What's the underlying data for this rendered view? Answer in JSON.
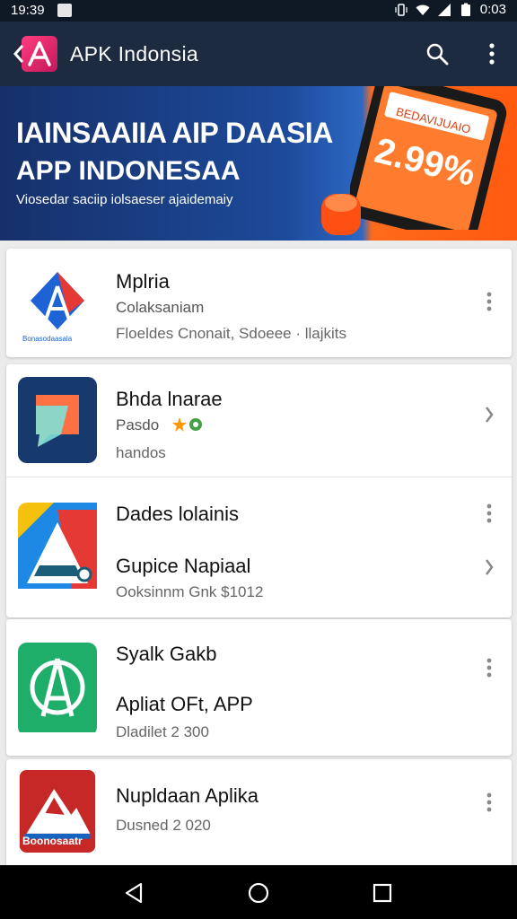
{
  "status_bar": {
    "time": "19:39",
    "clock_right": "0:03",
    "icons": [
      "notification-icon",
      "vibrate-icon",
      "wifi-icon",
      "signal-icon",
      "battery-icon"
    ]
  },
  "app_bar": {
    "title": "APK Indonsia",
    "back_icon": "chevron-left-icon",
    "actions": [
      "search-icon",
      "more-vert-icon"
    ]
  },
  "banner": {
    "line1": "IAINSAAIIA AIP DAASIA",
    "line2": "APP INDONESAA",
    "line3": "Viosedar saciip iolsaeser ajaidemaiy",
    "promo": "2.99%",
    "promo_label": "BEDAVIJUAIO",
    "brand_color": "#ff5a10"
  },
  "cards": [
    {
      "rows": [
        {
          "name": "Mplria",
          "sub": "Colaksaniam",
          "meta": "Floeldes Cnonait, Sdoeee · llajkits",
          "icon_name": "aplikasi-logo-icon",
          "icon_caption": "Bonasodaasala",
          "action": "more-vert-icon"
        }
      ]
    },
    {
      "rows": [
        {
          "name": "Bhda lnarae",
          "sub": "Pasdo",
          "meta": "handos",
          "icon_name": "chat-bubble-icon",
          "action": "chevron-right-icon"
        },
        {
          "name": "Dades lolainis",
          "sub": "Gupice Napiaal",
          "meta": "Ooksinnm Gnk $1012",
          "icon_name": "triangle-logo-icon",
          "action": "more-vert-icon",
          "action2": "chevron-right-icon"
        }
      ]
    },
    {
      "rows": [
        {
          "name": "Syalk Gakb",
          "sub": "Apliat OFt, APP",
          "meta": "Dladilet 2 300",
          "icon_name": "green-a-logo-icon",
          "action": "more-vert-icon"
        }
      ]
    },
    {
      "rows": [
        {
          "name": "Nupldaan Aplika",
          "sub": "",
          "meta": "Dusned 2 020",
          "icon_name": "red-mountain-logo-icon",
          "icon_caption": "Boonosaatr",
          "action": "more-vert-icon"
        }
      ]
    }
  ],
  "nav_bar": [
    "back-triangle-icon",
    "home-circle-icon",
    "recents-square-icon"
  ]
}
